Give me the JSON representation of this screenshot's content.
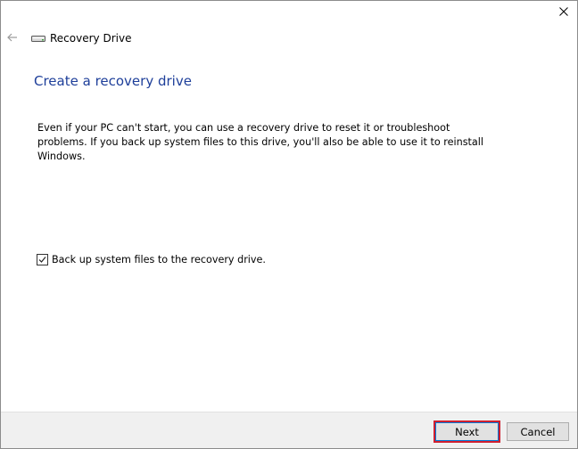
{
  "window": {
    "title": "Recovery Drive",
    "close_icon": "close-icon",
    "back_icon": "back-arrow-icon",
    "app_icon": "drive-icon"
  },
  "main": {
    "heading": "Create a recovery drive",
    "description": "Even if your PC can't start, you can use a recovery drive to reset it or troubleshoot problems. If you back up system files to this drive, you'll also be able to use it to reinstall Windows.",
    "backup_checkbox": {
      "label": "Back up system files to the recovery drive.",
      "checked": true
    }
  },
  "footer": {
    "next_label": "Next",
    "cancel_label": "Cancel"
  },
  "colors": {
    "heading": "#1e3f9a",
    "footer_bg": "#f0f0f0",
    "highlight": "#cf1f2f"
  }
}
